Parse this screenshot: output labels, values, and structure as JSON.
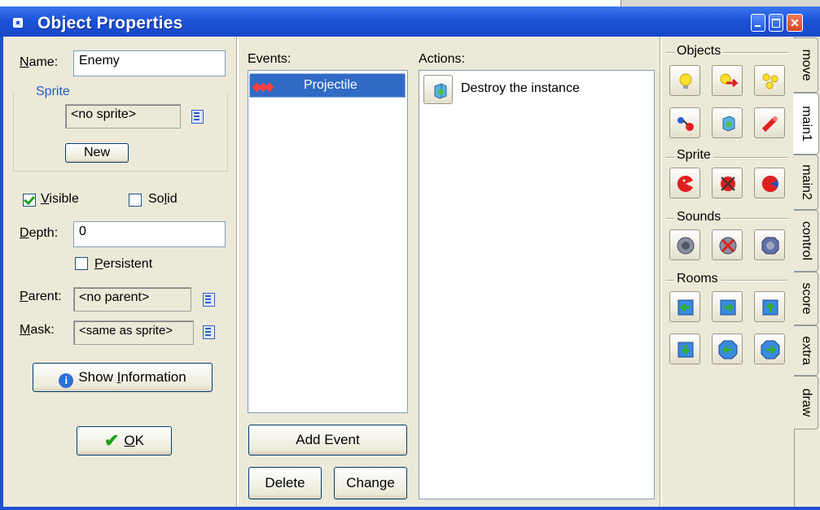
{
  "window": {
    "title": "Object Properties"
  },
  "left": {
    "name_label": "Name:",
    "name_value": "Enemy",
    "sprite_group": "Sprite",
    "sprite_value": "<no sprite>",
    "new_button": "New",
    "visible_label": "Visible",
    "visible_checked": true,
    "solid_label": "Solid",
    "solid_checked": false,
    "depth_label": "Depth:",
    "depth_value": "0",
    "persistent_label": "Persistent",
    "persistent_checked": false,
    "parent_label": "Parent:",
    "parent_value": "<no parent>",
    "mask_label": "Mask:",
    "mask_value": "<same as sprite>",
    "show_info_button": "Show Information",
    "ok_button": "OK"
  },
  "events": {
    "label": "Events:",
    "items": [
      {
        "label": "Projectile",
        "icon": "collision-icon",
        "selected": true
      }
    ],
    "add_button": "Add Event",
    "delete_button": "Delete",
    "change_button": "Change"
  },
  "actions": {
    "label": "Actions:",
    "items": [
      {
        "label": "Destroy the instance",
        "icon": "destroy-instance-icon"
      }
    ]
  },
  "palette": {
    "groups": [
      {
        "label": "Objects",
        "icons": [
          "create-instance-icon",
          "create-moving-icon",
          "create-random-icon",
          "change-instance-icon",
          "destroy-instance-icon",
          "destroy-at-position-icon"
        ]
      },
      {
        "label": "Sprite",
        "icons": [
          "change-sprite-icon",
          "transform-sprite-icon",
          "color-sprite-icon"
        ]
      },
      {
        "label": "Sounds",
        "icons": [
          "play-sound-icon",
          "stop-sound-icon",
          "check-sound-icon"
        ]
      },
      {
        "label": "Rooms",
        "icons": [
          "previous-room-icon",
          "next-room-icon",
          "restart-room-icon",
          "different-room-icon",
          "check-previous-icon",
          "check-next-icon"
        ]
      }
    ]
  },
  "tabs": [
    "move",
    "main1",
    "main2",
    "control",
    "score",
    "extra",
    "draw"
  ],
  "active_tab": "main1"
}
